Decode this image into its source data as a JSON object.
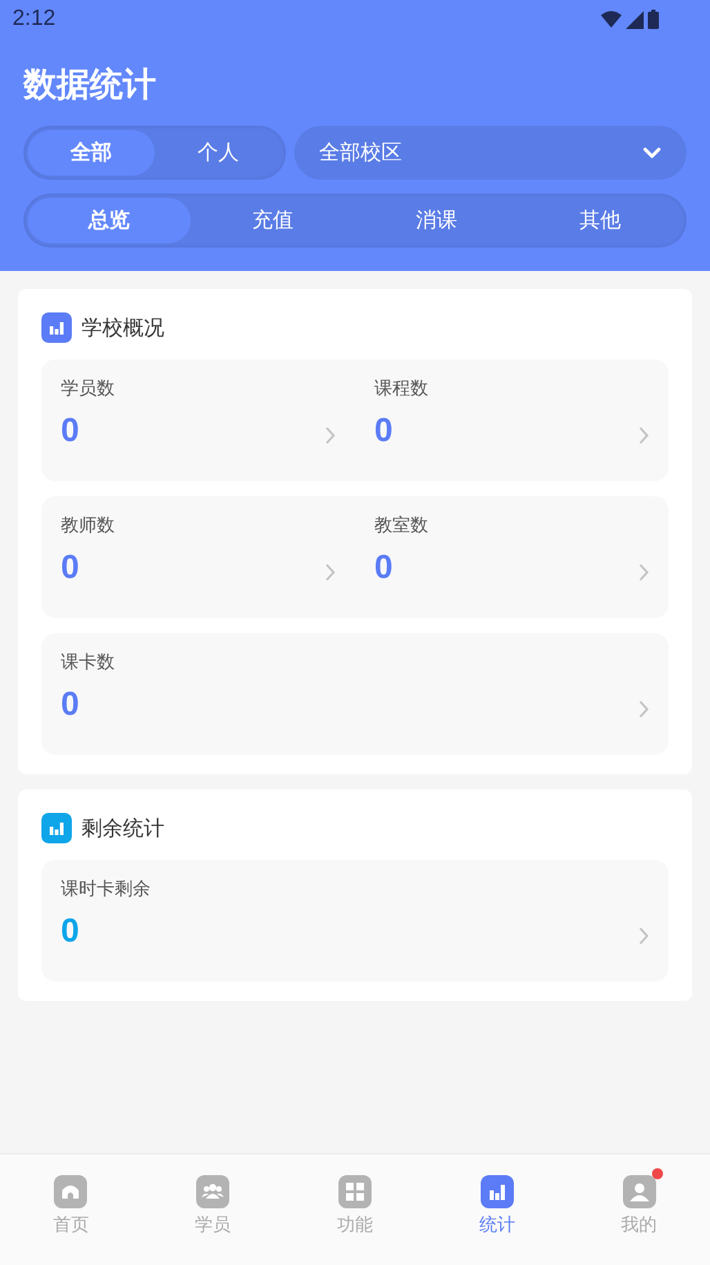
{
  "status_bar": {
    "time": "2:12"
  },
  "title": "数据统计",
  "scope_tabs": [
    {
      "label": "全部",
      "selected": true
    },
    {
      "label": "个人",
      "selected": false
    }
  ],
  "campus_select": {
    "value": "全部校区"
  },
  "category_tabs": [
    {
      "label": "总览",
      "selected": true
    },
    {
      "label": "充值",
      "selected": false
    },
    {
      "label": "消课",
      "selected": false
    },
    {
      "label": "其他",
      "selected": false
    }
  ],
  "sections": [
    {
      "title": "学校概况",
      "color": "#5b7cf6",
      "tiles": [
        {
          "items": [
            {
              "label": "学员数",
              "value": "0"
            },
            {
              "label": "课程数",
              "value": "0"
            }
          ]
        },
        {
          "items": [
            {
              "label": "教师数",
              "value": "0"
            },
            {
              "label": "教室数",
              "value": "0"
            }
          ]
        },
        {
          "items": [
            {
              "label": "课卡数",
              "value": "0"
            }
          ]
        }
      ]
    },
    {
      "title": "剩余统计",
      "color": "#0ea5e9",
      "tiles": [
        {
          "items": [
            {
              "label": "课时卡剩余",
              "value": "0"
            }
          ]
        }
      ]
    }
  ],
  "bottom_nav": [
    {
      "kind": "home",
      "label": "首页",
      "selected": false,
      "badge": false
    },
    {
      "kind": "people",
      "label": "学员",
      "selected": false,
      "badge": false
    },
    {
      "kind": "grid",
      "label": "功能",
      "selected": false,
      "badge": false
    },
    {
      "kind": "chart",
      "label": "统计",
      "selected": true,
      "badge": false
    },
    {
      "kind": "user",
      "label": "我的",
      "selected": false,
      "badge": true
    }
  ]
}
